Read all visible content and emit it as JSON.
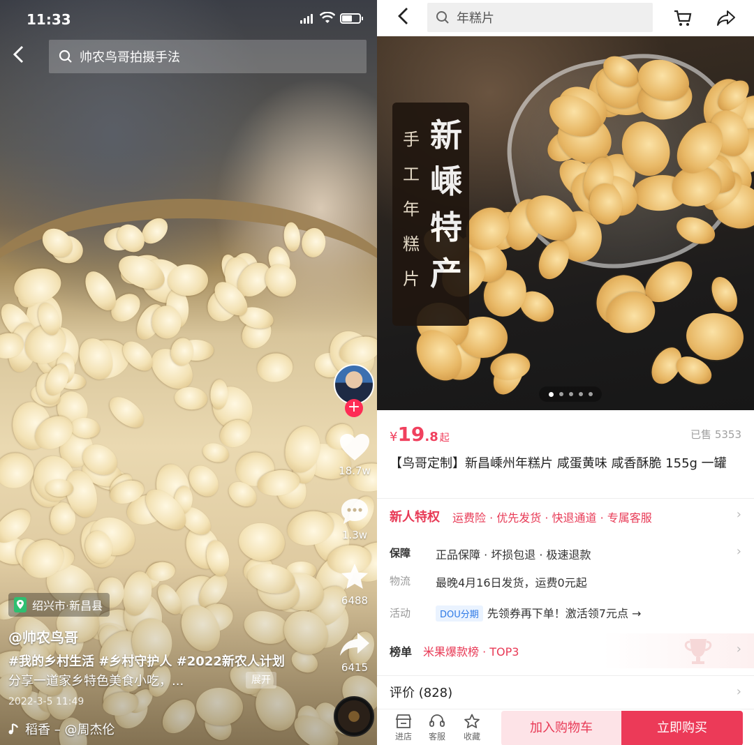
{
  "status_bar": {
    "time": "11:33"
  },
  "video": {
    "search_text": "帅农鸟哥拍摄手法",
    "actions": {
      "likes": "18.7w",
      "comments": "1.3w",
      "favorites": "6488",
      "shares": "6415"
    },
    "location": "绍兴市·新昌县",
    "author": "@帅农鸟哥",
    "tags": "#我的乡村生活 #乡村守护人 #2022新农人计划",
    "description": "分享一道家乡特色美食小吃，...",
    "expand_label": "展开",
    "date": "2022-3-5 11:49",
    "music": "稻香 – @周杰伦",
    "icons": [
      "back-icon",
      "search-icon",
      "heart-icon",
      "comment-icon",
      "star-icon",
      "share-icon",
      "location-pin-icon",
      "music-note-icon"
    ]
  },
  "product": {
    "search_text": "年糕片",
    "banner": {
      "left_text": "手工年糕片",
      "right_text": "新嵊特产"
    },
    "carousel": {
      "count": 5,
      "active": 0
    },
    "price": {
      "currency": "¥",
      "integer": "19",
      "decimal": ".8",
      "suffix": "起"
    },
    "sold": "已售 5353",
    "title": "【鸟哥定制】新昌嵊州年糕片 咸蛋黄味 咸香酥脆 155g 一罐",
    "new_user": {
      "label": "新人特权",
      "items": "运费险 · 优先发货 · 快退通道 · 专属客服"
    },
    "guarantee": {
      "label": "保障",
      "value": "正品保障 · 坏损包退 · 极速退款"
    },
    "shipping": {
      "label": "物流",
      "value": "最晚4月16日发货，运费0元起"
    },
    "promo": {
      "label": "活动",
      "badge": "DOU分期",
      "value": "先领券再下单！激活领7元点 →"
    },
    "ranking": {
      "label": "榜单",
      "value": "米果爆款榜 · TOP3"
    },
    "reviews": {
      "label": "评价 (828)"
    },
    "bottom": {
      "shop": "进店",
      "service": "客服",
      "favorite": "收藏",
      "add_to_cart": "加入购物车",
      "buy_now": "立即购买"
    },
    "colors": {
      "accent": "#ec3a58",
      "price": "#f0415e",
      "dou": "#2e7ae6"
    }
  }
}
